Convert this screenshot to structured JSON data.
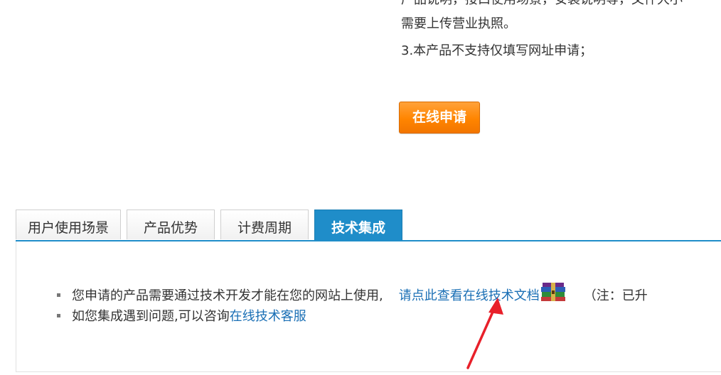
{
  "notes": {
    "partial_line": "产品说明，接口使用场景，安装说明等，文件大小",
    "line2": "需要上传营业执照。",
    "line3": "3.本产品不支持仅填写网址申请；"
  },
  "apply_button": {
    "label": "在线申请"
  },
  "tabs": [
    {
      "label": "用户使用场景",
      "active": false
    },
    {
      "label": "产品优势",
      "active": false
    },
    {
      "label": "计费周期",
      "active": false
    },
    {
      "label": "技术集成",
      "active": true
    }
  ],
  "content": {
    "item1": {
      "text": "您申请的产品需要通过技术开发才能在您的网站上使用,",
      "link": "请点此查看在线技术文档",
      "icon": "archive-icon",
      "note": "（注：已升"
    },
    "item2": {
      "text": "如您集成遇到问题,可以咨询",
      "link": "在线技术客服"
    }
  },
  "colors": {
    "accent": "#1f8dc9",
    "link": "#1a6fb5",
    "button": "#ff8500",
    "arrow": "#e8202a"
  }
}
